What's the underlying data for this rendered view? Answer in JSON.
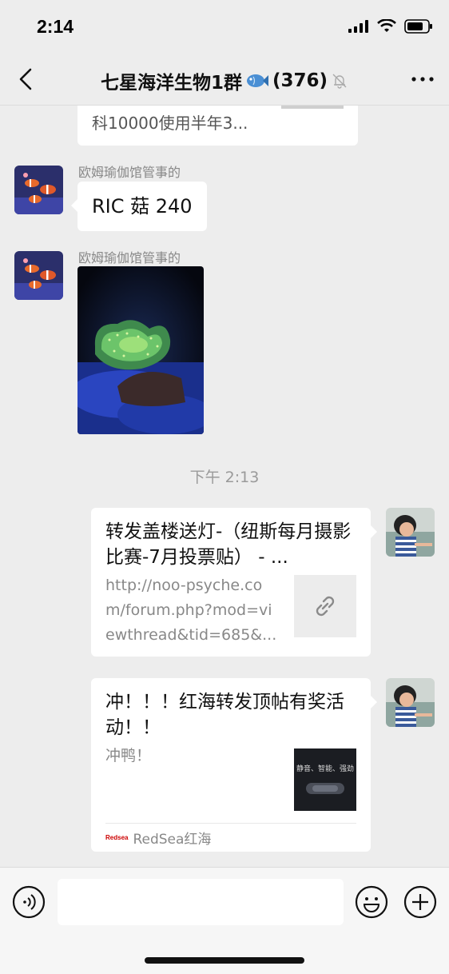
{
  "status": {
    "time": "2:14"
  },
  "nav": {
    "title": "七星海洋生物1群",
    "count": "(376)"
  },
  "messages": {
    "previous_text": "科10000使用半年3...",
    "sender1": "欧姆瑜伽馆管事的",
    "text1": "RIC 菇 240",
    "sender2": "欧姆瑜伽馆管事的",
    "timestamp": "下午 2:13",
    "card1": {
      "title": "转发盖楼送灯-（纽斯每月摄影比赛-7月投票贴） - ...",
      "desc": "http://noo-psyche.com/forum.php?mod=viewthread&tid=685&..."
    },
    "card2": {
      "title": "冲！！！红海转发顶帖有奖活动！！",
      "desc": "冲鸭！",
      "thumb_caption": "静音、智能、强劲",
      "logo": "Redsea",
      "source": "RedSea红海"
    }
  },
  "input": {
    "placeholder": ""
  },
  "icons": {
    "back": "chevron-left-icon",
    "more": "more-dots-icon",
    "mute": "bell-off-icon",
    "fish": "fish-icon",
    "voice": "voice-icon",
    "emoji": "emoji-icon",
    "plus": "plus-icon",
    "link": "link-icon"
  },
  "colors": {
    "background": "#ededed",
    "bubble": "#ffffff",
    "link_text": "#888888"
  }
}
